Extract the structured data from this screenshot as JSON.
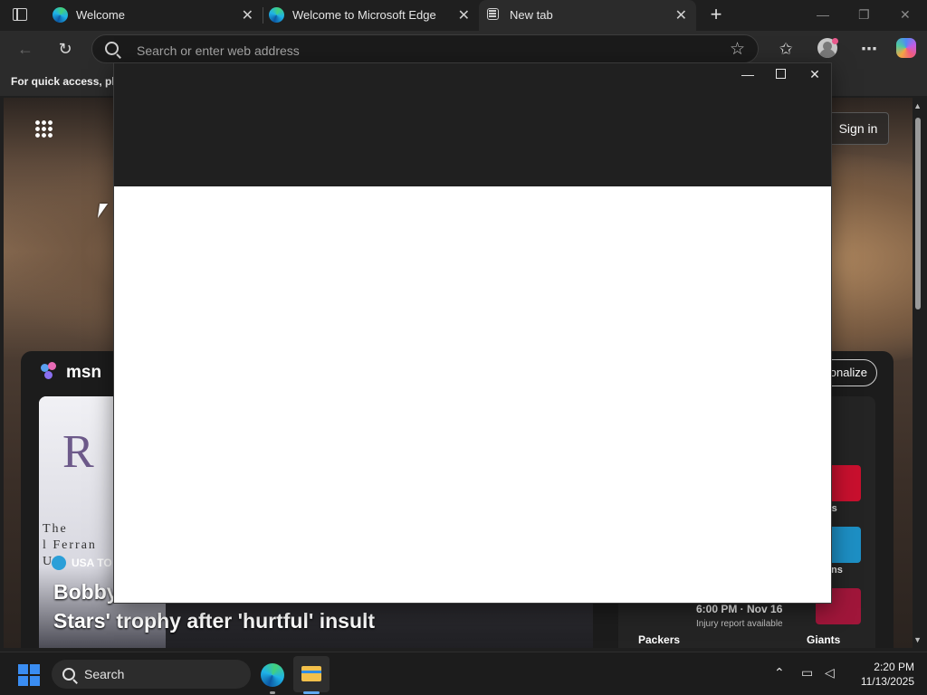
{
  "browser": {
    "tabs": [
      {
        "title": "Welcome",
        "active": false
      },
      {
        "title": "Welcome to Microsoft Edge",
        "active": false
      },
      {
        "title": "New tab",
        "active": true
      }
    ],
    "address_placeholder": "Search or enter web address",
    "favorites_hint": "For quick access, plac"
  },
  "newtab": {
    "signin_label": "Sign in",
    "msn_label": "msn",
    "personalize_label": "onalize",
    "story": {
      "logo_text": "R",
      "serif_lines": [
        "The",
        "l Ferran",
        "U"
      ],
      "source": "USA TO",
      "headline_line1": "Bobby",
      "headline_line2": "Stars' trophy after 'hurtful' insult"
    },
    "sports": {
      "tile1_label": "ts",
      "tile2_label": "ins",
      "game_time": "6:00 PM · Nov 16",
      "game_note": "Injury report available",
      "home_team": "Packers",
      "away_team": "Giants"
    }
  },
  "taskbar": {
    "search_label": "Search",
    "time": "2:20 PM",
    "date": "11/13/2025"
  },
  "colors": {
    "accent_blue": "#3a8df2",
    "story_source_blue": "#2b9fd8"
  }
}
